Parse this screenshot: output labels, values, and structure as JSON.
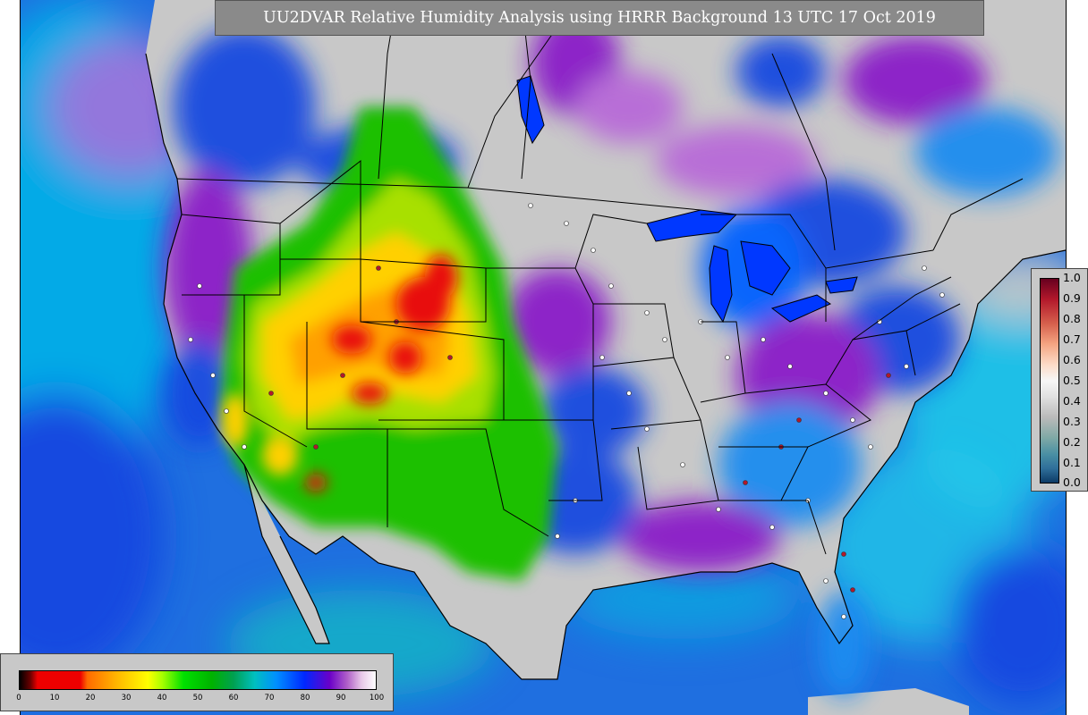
{
  "title": "UU2DVAR Relative Humidity Analysis using HRRR Background 13 UTC 17 Oct 2019",
  "colorbar_vertical": {
    "ticks": [
      "1.0",
      "0.9",
      "0.8",
      "0.7",
      "0.6",
      "0.5",
      "0.4",
      "0.3",
      "0.2",
      "0.1",
      "0.0"
    ]
  },
  "colorbar_horizontal": {
    "ticks": [
      "0",
      "10",
      "20",
      "30",
      "40",
      "50",
      "60",
      "70",
      "80",
      "90",
      "100"
    ]
  },
  "colors": {
    "ocean": "#1f6fe0",
    "dry": "#ffd000",
    "very_dry": "#e81010",
    "moist": "#1ec000",
    "saturated": "#c8c8c8",
    "purple": "#8a1fc8"
  }
}
